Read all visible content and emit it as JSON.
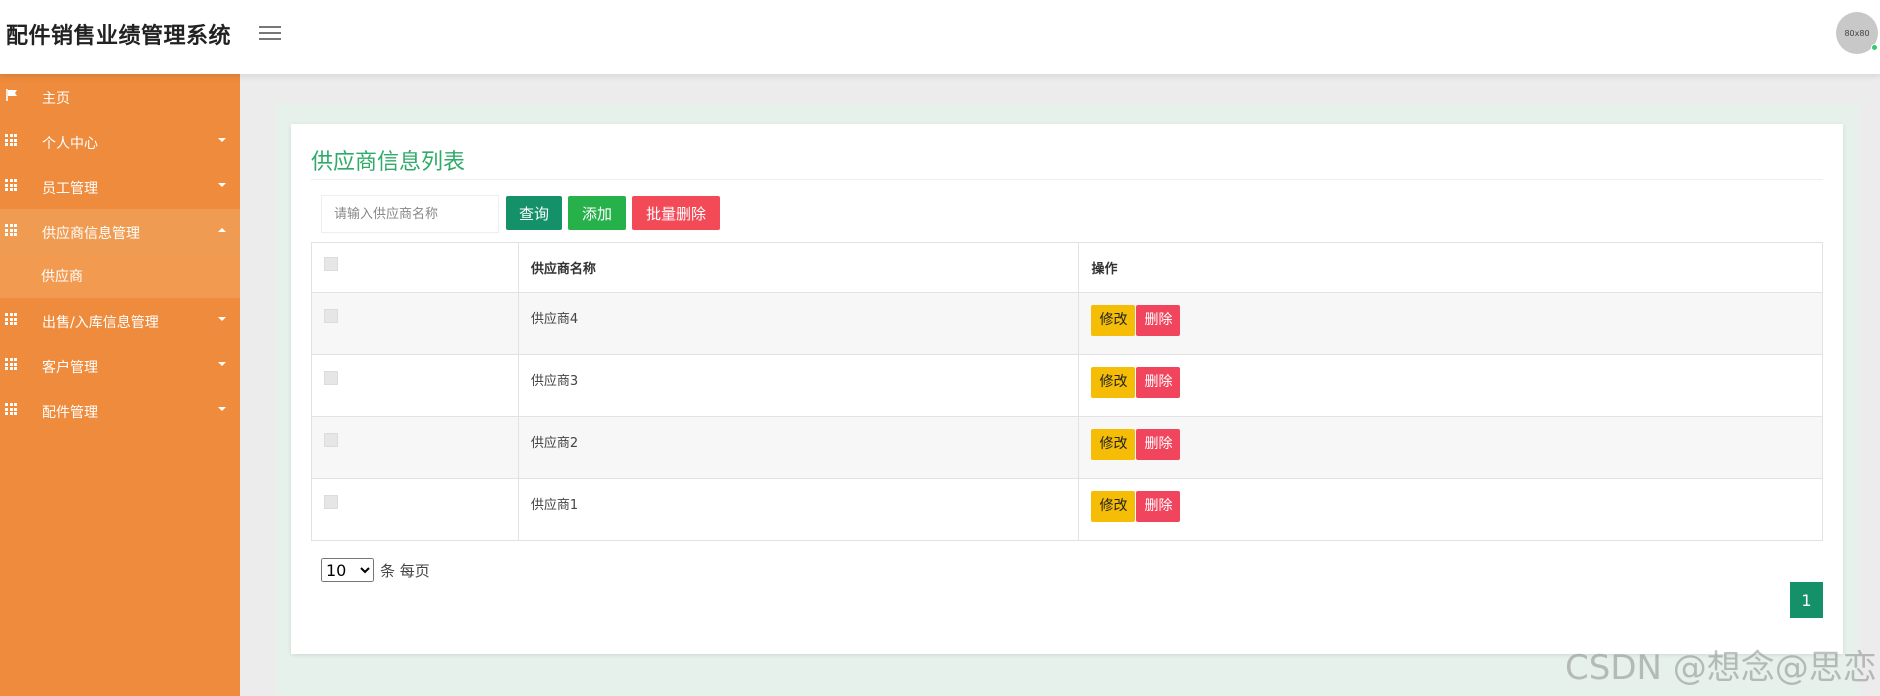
{
  "header": {
    "title": "配件销售业绩管理系统",
    "avatar_text": "80x80"
  },
  "sidebar": {
    "items": [
      {
        "label": "主页",
        "icon": "flag-icon"
      },
      {
        "label": "个人中心",
        "icon": "grid-icon"
      },
      {
        "label": "员工管理",
        "icon": "grid-icon"
      },
      {
        "label": "供应商信息管理",
        "icon": "grid-icon",
        "expanded": true
      },
      {
        "label": "出售/入库信息管理",
        "icon": "grid-icon"
      },
      {
        "label": "客户管理",
        "icon": "grid-icon"
      },
      {
        "label": "配件管理",
        "icon": "grid-icon"
      }
    ],
    "sub_items": [
      {
        "label": "供应商"
      }
    ]
  },
  "main": {
    "title": "供应商信息列表",
    "search": {
      "placeholder": "请输入供应商名称"
    },
    "buttons": {
      "query": "查询",
      "add": "添加",
      "batch_delete": "批量删除"
    },
    "table": {
      "columns": [
        "",
        "供应商名称",
        "操作"
      ],
      "rows": [
        {
          "name": "供应商4"
        },
        {
          "name": "供应商3"
        },
        {
          "name": "供应商2"
        },
        {
          "name": "供应商1"
        }
      ],
      "edit_label": "修改",
      "delete_label": "删除"
    },
    "pagination": {
      "page_size": "10",
      "page_size_suffix": "条 每页",
      "current_page": "1"
    }
  },
  "watermark": "CSDN @想念@思恋",
  "colors": {
    "sidebar": "#ee8b3c",
    "title_green": "#2faa6a",
    "query_btn": "#15916a",
    "add_btn": "#27b14a",
    "delete_btn": "#f34a58",
    "edit_btn": "#f5bd05"
  }
}
